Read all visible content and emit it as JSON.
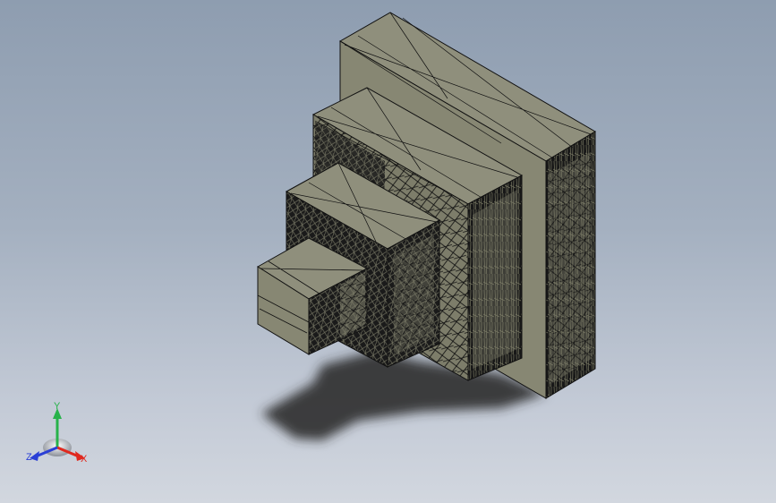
{
  "viewport": {
    "background_top": "#8e9db0",
    "background_bottom": "#d2d7df"
  },
  "model": {
    "face_color": "#878773",
    "top_color": "#8f8f7c",
    "edge_color": "#111111",
    "shadow_color": "#2d2d2d"
  },
  "triad": {
    "x_label": "X",
    "y_label": "Y",
    "z_label": "Z",
    "x_color": "#e0291f",
    "y_color": "#27b24a",
    "z_color": "#2a3fd6"
  }
}
